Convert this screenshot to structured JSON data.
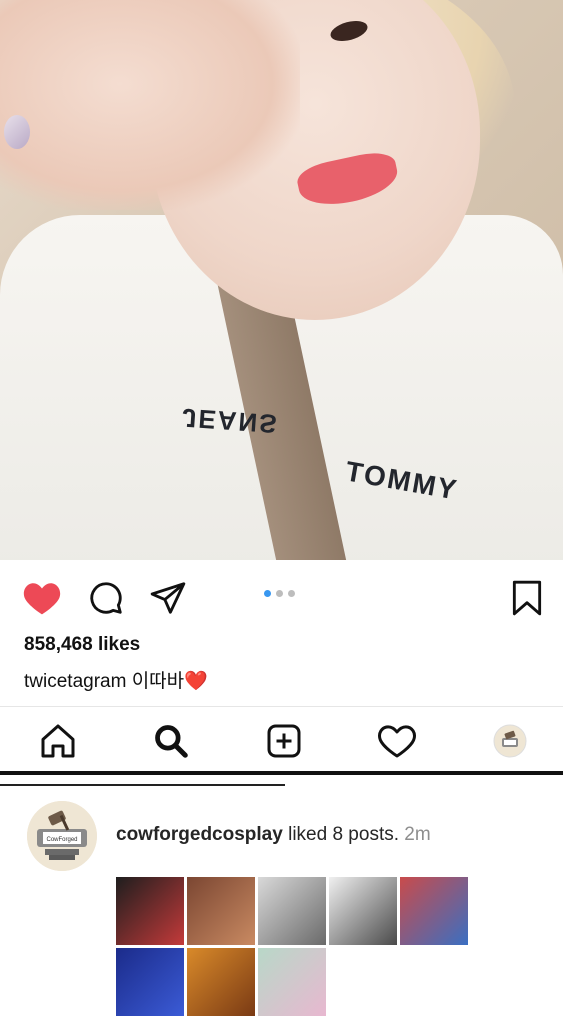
{
  "post": {
    "photo_text_top": "JEANS",
    "photo_text_bottom": "TOMMY",
    "likes": "858,468 likes",
    "caption_user": "twicetagram",
    "caption_text": " 이따바❤️",
    "carousel": {
      "count": 3,
      "active": 0
    }
  },
  "icons": {
    "like": "heart-filled-icon",
    "comment": "comment-bubble-icon",
    "share": "paper-plane-icon",
    "save": "bookmark-icon",
    "home": "home-icon",
    "search": "search-icon",
    "add": "add-post-icon",
    "activity": "heart-outline-icon",
    "profile": "profile-avatar-icon"
  },
  "activity": {
    "user": "cowforgedcosplay",
    "action": " liked 8 posts. ",
    "time": "2m",
    "thumbnails": [
      {
        "colors": [
          "#1e1e1e",
          "#c43a3a"
        ]
      },
      {
        "colors": [
          "#7b4632",
          "#c98a62"
        ]
      },
      {
        "colors": [
          "#d9d9d9",
          "#6a6a6a"
        ]
      },
      {
        "colors": [
          "#f0f0f0",
          "#4a4a4a"
        ]
      },
      {
        "colors": [
          "#c94b4b",
          "#3a6fc2"
        ]
      },
      {
        "colors": [
          "#1b2b8a",
          "#3b5bd6"
        ]
      },
      {
        "colors": [
          "#d98a2a",
          "#7a3a14"
        ]
      },
      {
        "colors": [
          "#b8d8c8",
          "#e8b8d0"
        ]
      }
    ]
  },
  "colors": {
    "like_red": "#ed4956",
    "dot_active": "#3897f0",
    "dot_inactive": "#bdbdbd"
  }
}
